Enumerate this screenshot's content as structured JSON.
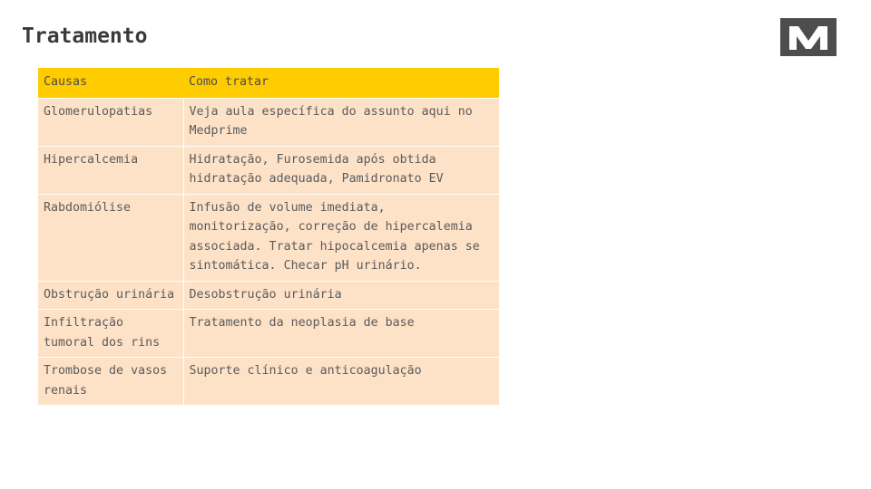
{
  "slide": {
    "title": "Tratamento",
    "logo_name": "m-logo"
  },
  "table": {
    "headers": [
      "Causas",
      "Como tratar"
    ],
    "rows": [
      {
        "cause": "Glomerulopatias",
        "treatment": "Veja aula específica do assunto aqui no Medprime"
      },
      {
        "cause": "Hipercalcemia",
        "treatment": "Hidratação, Furosemida após obtida hidratação adequada, Pamidronato EV"
      },
      {
        "cause": "Rabdomiólise",
        "treatment": "Infusão de volume imediata, monitorização, correção de hipercalemia associada. Tratar hipocalcemia apenas se sintomática. Checar pH urinário."
      },
      {
        "cause": "Obstrução urinária",
        "treatment": "Desobstrução urinária"
      },
      {
        "cause": "Infiltração tumoral dos rins",
        "treatment": "Tratamento da neoplasia de base"
      },
      {
        "cause": "Trombose de vasos renais",
        "treatment": "Suporte clínico e anticoagulação"
      }
    ]
  },
  "colors": {
    "header_bg": "#ffcc00",
    "row_bg": "#fde2c8",
    "text": "#5b5b5b",
    "title": "#3a3a3a",
    "logo": "#4d4d4d"
  }
}
